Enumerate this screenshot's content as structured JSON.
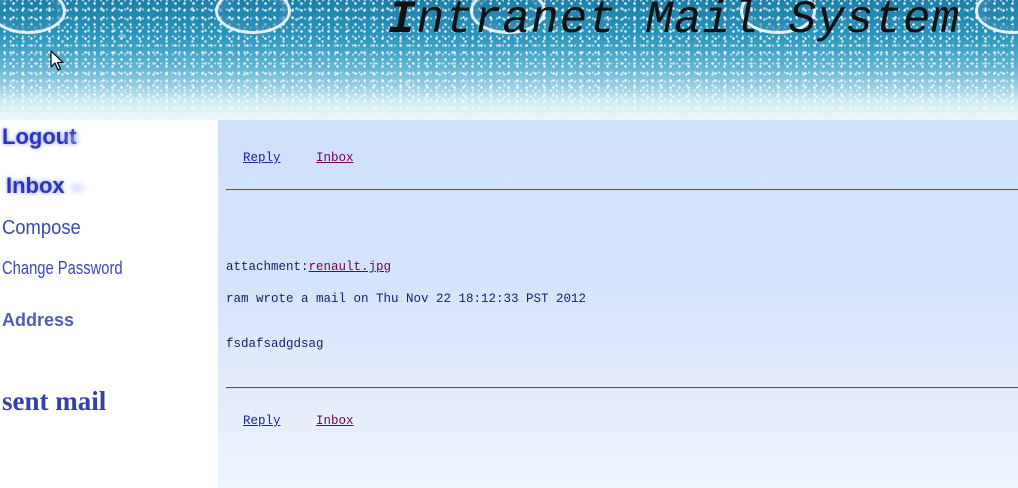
{
  "header": {
    "title_first": "I",
    "title_rest": "ntranet Mail System",
    "cursor_icon": "mouse-pointer-icon"
  },
  "sidebar": {
    "logout": "Logout",
    "inbox": "Inbox",
    "compose": "Compose",
    "change_password": "Change Password",
    "address": "Address",
    "sent_mail": "sent mail"
  },
  "nav_top": {
    "reply": "Reply",
    "inbox": "Inbox"
  },
  "message": {
    "attachment_label": "attachment:",
    "attachment_file": "renault.jpg ",
    "meta": "ram wrote a mail on Thu Nov 22 18:12:33 PST 2012",
    "body": "fsdafsadgdsag"
  },
  "nav_bottom": {
    "reply": "Reply",
    "inbox": "Inbox"
  },
  "colors": {
    "link_reply": "#1a22a0",
    "link_visited": "#700050",
    "sidebar_text": "#3a4ab0",
    "content_bg": "#cfe0fb"
  }
}
